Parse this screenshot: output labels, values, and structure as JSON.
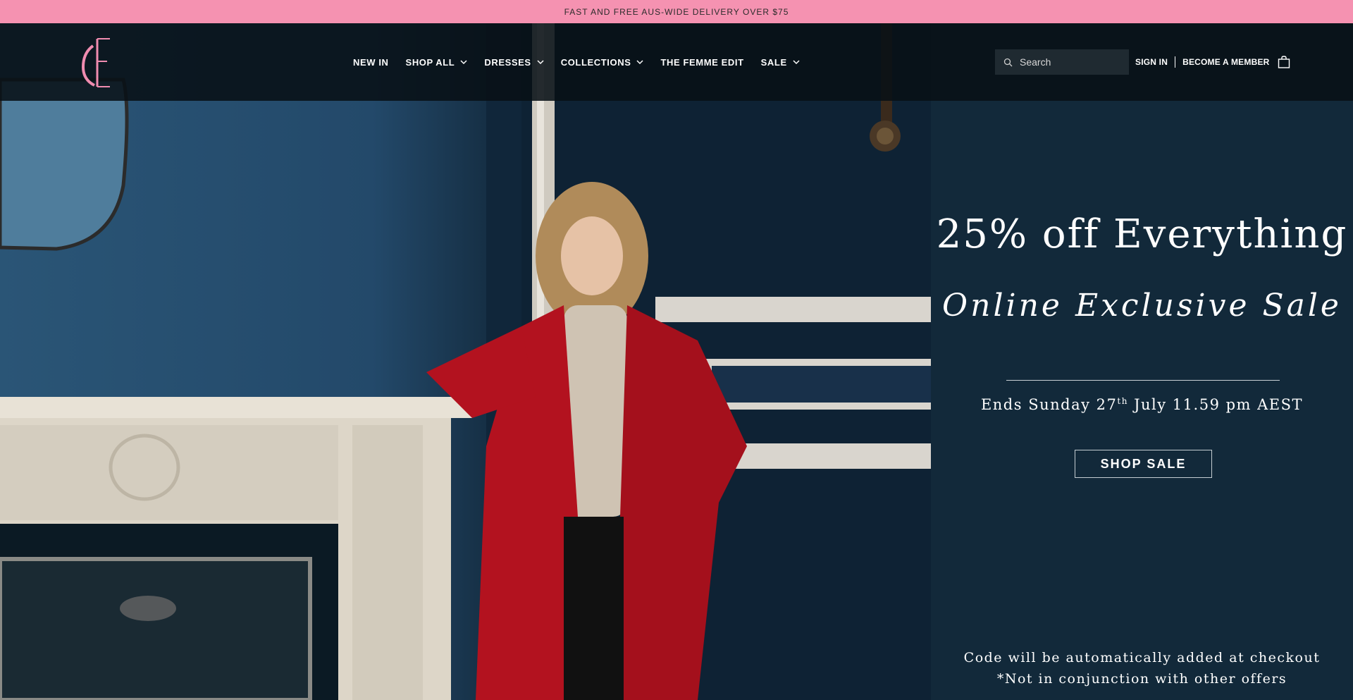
{
  "announcement": {
    "text": "FAST AND FREE AUS-WIDE DELIVERY OVER $75"
  },
  "header": {
    "logo_label": "FE",
    "nav": [
      {
        "label": "NEW IN",
        "has_dropdown": false
      },
      {
        "label": "SHOP ALL",
        "has_dropdown": true
      },
      {
        "label": "DRESSES",
        "has_dropdown": true
      },
      {
        "label": "COLLECTIONS",
        "has_dropdown": true
      },
      {
        "label": "THE FEMME EDIT",
        "has_dropdown": false
      },
      {
        "label": "SALE",
        "has_dropdown": true
      }
    ],
    "search": {
      "placeholder": "Search"
    },
    "sign_in": "SIGN IN",
    "become_member": "BECOME A MEMBER"
  },
  "promo": {
    "title": "25% off Everything",
    "script_line": "Online Exclusive Sale",
    "ends_prefix": "Ends Sunday 27",
    "ends_sup": "th",
    "ends_suffix": " July 11.59 pm AEST",
    "cta": "SHOP SALE",
    "note1": "Code will be automatically added at checkout",
    "note2": "*Not in conjunction with other offers"
  },
  "colors": {
    "announcement_bg": "#f592b1",
    "logo_pink": "#f08cb0",
    "panel_bg": "#12293a",
    "coat_red": "#b3121f"
  }
}
